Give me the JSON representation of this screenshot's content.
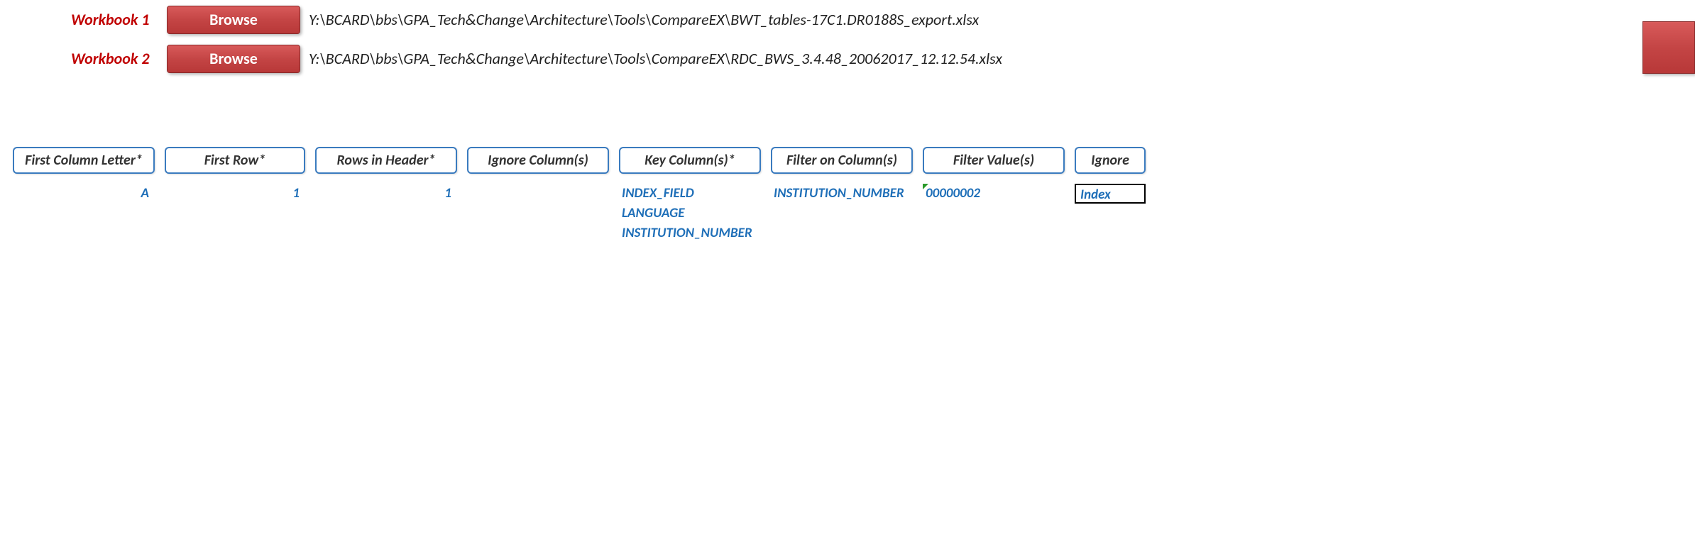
{
  "workbooks": [
    {
      "label": "Workbook 1",
      "button": "Browse",
      "path": "Y:\\BCARD\\bbs\\GPA_Tech&Change\\Architecture\\Tools\\CompareEX\\BWT_tables-17C1.DR0188S_export.xlsx"
    },
    {
      "label": "Workbook 2",
      "button": "Browse",
      "path": "Y:\\BCARD\\bbs\\GPA_Tech&Change\\Architecture\\Tools\\CompareEX\\RDC_BWS_3.4.48_20062017_12.12.54.xlsx"
    }
  ],
  "columns": {
    "first_col_letter": {
      "header": "First Column Letter*",
      "values": [
        "A"
      ]
    },
    "first_row": {
      "header": "First Row*",
      "values": [
        "1"
      ]
    },
    "rows_in_header": {
      "header": "Rows in Header*",
      "values": [
        "1"
      ]
    },
    "ignore_columns": {
      "header": "Ignore Column(s)",
      "values": []
    },
    "key_columns": {
      "header": "Key Column(s)*",
      "values": [
        "INDEX_FIELD",
        "LANGUAGE",
        "INSTITUTION_NUMBER"
      ]
    },
    "filter_on_columns": {
      "header": "Filter on Column(s)",
      "values": [
        "INSTITUTION_NUMBER"
      ]
    },
    "filter_values": {
      "header": "Filter Value(s)",
      "values": [
        "00000002"
      ]
    },
    "ignore": {
      "header": "Ignore",
      "values": [
        "Index"
      ]
    }
  }
}
